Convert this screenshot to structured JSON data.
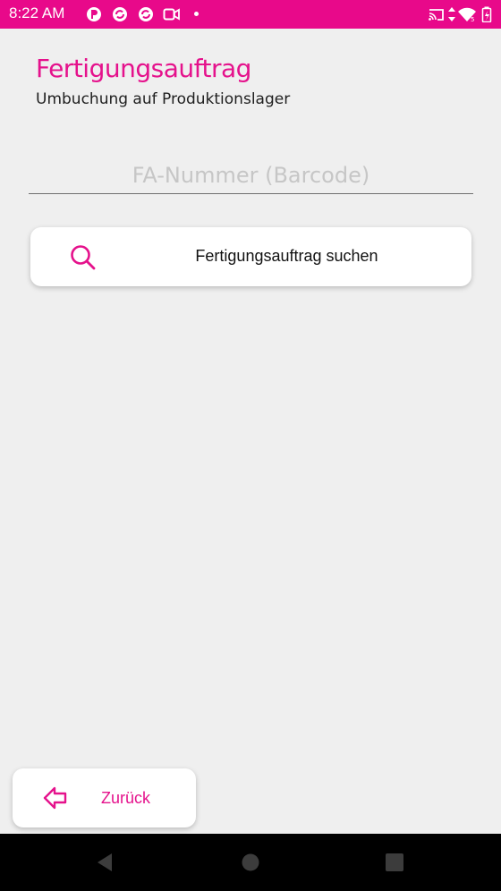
{
  "status_bar": {
    "time": "8:22 AM",
    "left_icons": [
      "app-notification-icon",
      "sync-icon",
      "sync-icon",
      "video-icon",
      "dot-icon"
    ],
    "right_icons": [
      "cast-icon",
      "data-arrows-icon",
      "wifi-icon",
      "battery-icon"
    ],
    "background": "#e8098a"
  },
  "header": {
    "title": "Fertigungsauftrag",
    "subtitle": "Umbuchung auf Produktionslager"
  },
  "fa_input": {
    "value": "",
    "placeholder": "FA-Nummer (Barcode)"
  },
  "search_button": {
    "icon": "search-icon",
    "label": "Fertigungsauftrag suchen"
  },
  "back_button": {
    "icon": "back-arrow-icon",
    "label": "Zurück"
  },
  "nav_bar": {
    "buttons": [
      "back-triangle",
      "home-circle",
      "recents-square"
    ]
  },
  "colors": {
    "accent": "#e5128c",
    "background": "#efefef"
  }
}
